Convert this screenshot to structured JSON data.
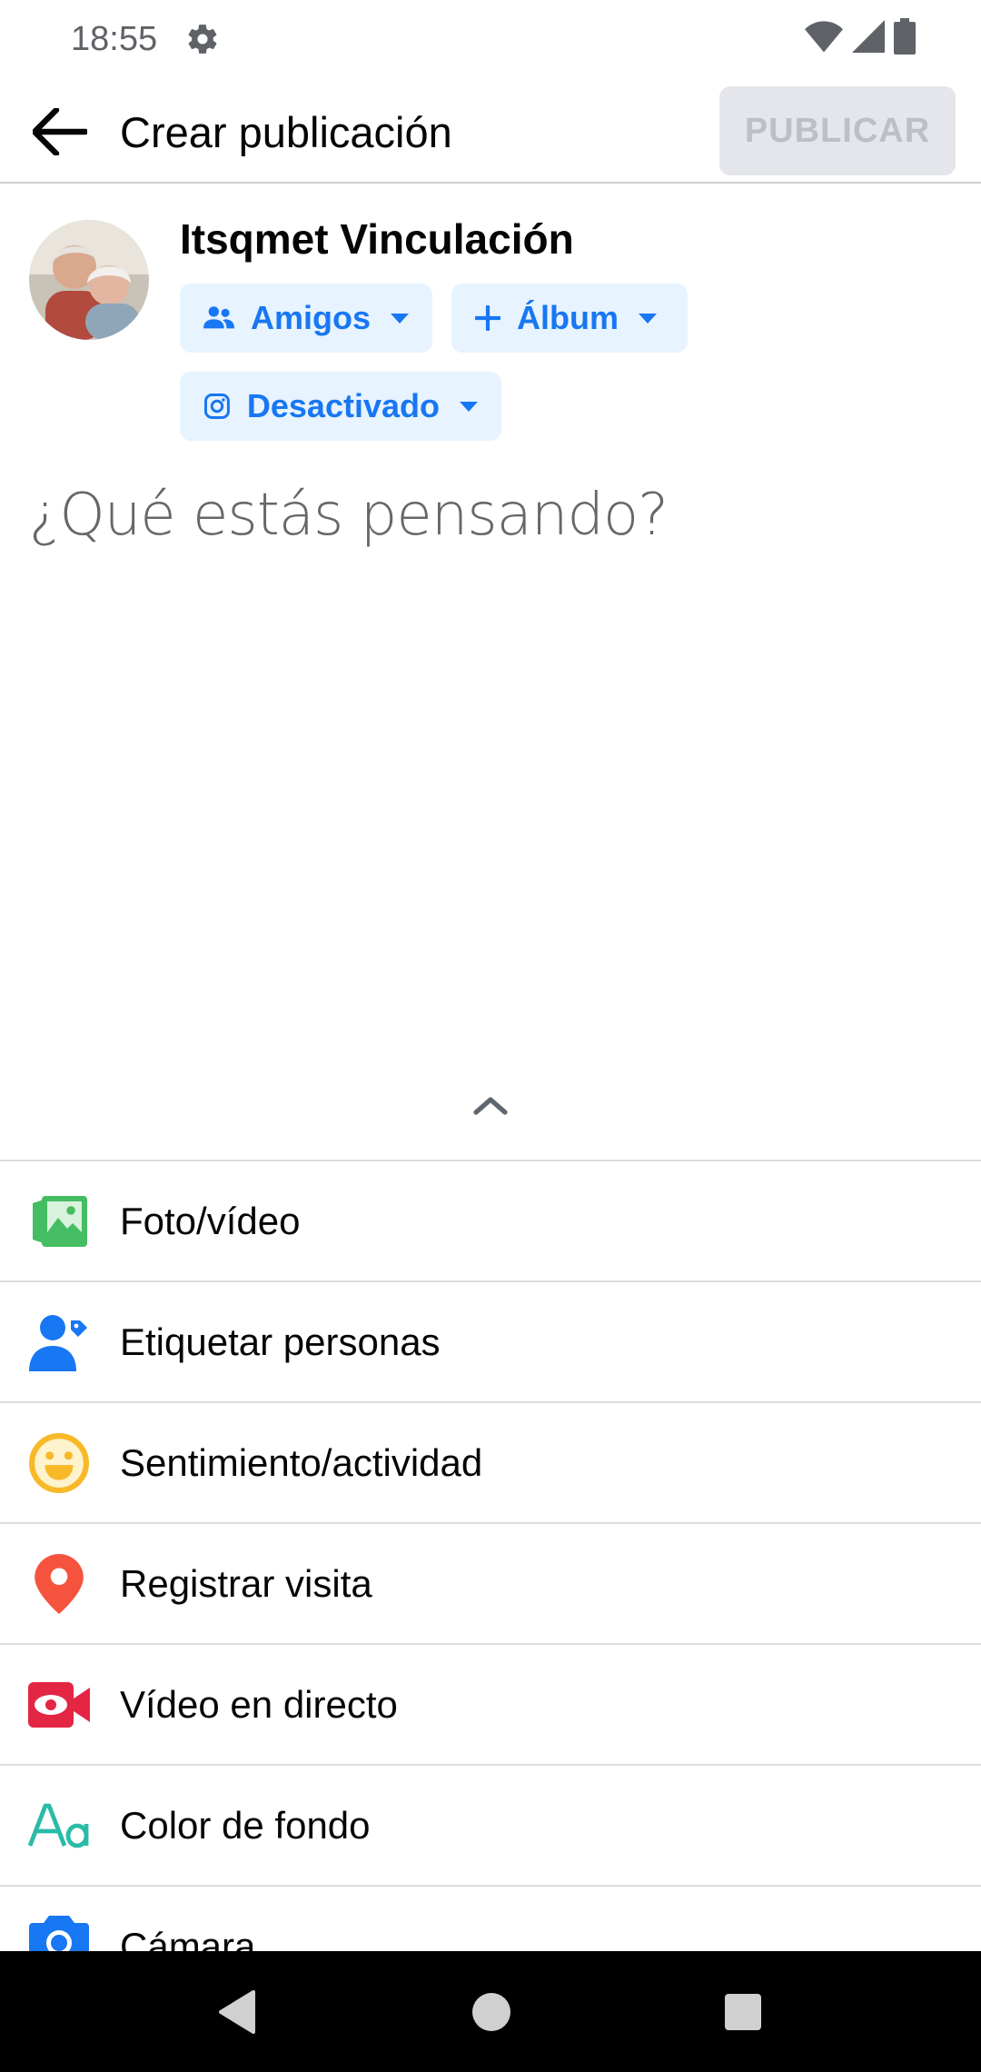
{
  "status_bar": {
    "time": "18:55"
  },
  "app_bar": {
    "title": "Crear publicación",
    "publish_label": "PUBLICAR"
  },
  "composer": {
    "user_name": "Itsqmet Vinculación",
    "audience_label": "Amigos",
    "album_label": "Álbum",
    "instagram_label": "Desactivado",
    "placeholder": "¿Qué estás pensando?"
  },
  "actions": [
    {
      "label": "Foto/vídeo",
      "icon": "photo-video-icon",
      "color": "#45bd62"
    },
    {
      "label": "Etiquetar personas",
      "icon": "tag-people-icon",
      "color": "#1877f2"
    },
    {
      "label": "Sentimiento/actividad",
      "icon": "feeling-icon",
      "color": "#f7b928"
    },
    {
      "label": "Registrar visita",
      "icon": "location-pin-icon",
      "color": "#f5533d"
    },
    {
      "label": "Vídeo en directo",
      "icon": "live-video-icon",
      "color": "#e42645"
    },
    {
      "label": "Color de fondo",
      "icon": "background-color-icon",
      "color": "#2abba7"
    },
    {
      "label": "Cámara",
      "icon": "camera-icon",
      "color": "#1877f2"
    }
  ],
  "colors": {
    "accent": "#1877f2",
    "chip_bg": "#e7f3ff",
    "publish_disabled_bg": "#e4e6eb"
  }
}
